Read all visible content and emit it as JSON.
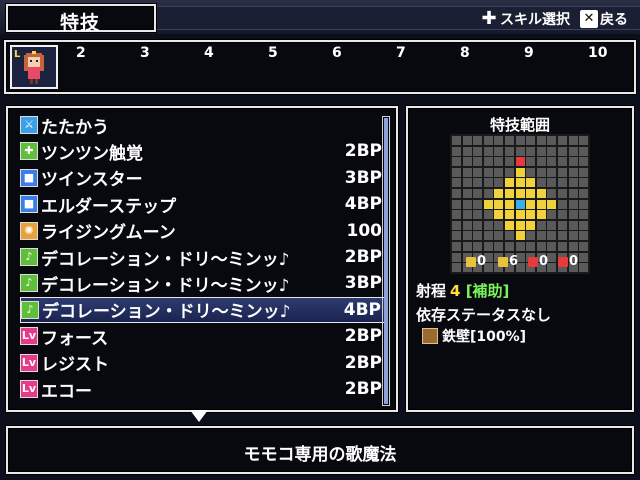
{
  "header": {
    "title": "特技",
    "hints": [
      {
        "icon": "dpad-icon",
        "label": "スキル選択"
      },
      {
        "icon": "close-button-icon",
        "label": "戻る"
      }
    ]
  },
  "party": {
    "slot1_marker": "L",
    "slot_numbers": [
      "2",
      "3",
      "4",
      "5",
      "6",
      "7",
      "8",
      "9",
      "10"
    ]
  },
  "skills": [
    {
      "name": "たたかう",
      "cost": "",
      "icon": "sword-icon",
      "icon_color": "#3aa0e8",
      "icon_glyph": "⚔"
    },
    {
      "name": "ツンツン触覚",
      "cost": "2BP",
      "icon": "plus-icon",
      "icon_color": "#5fbf3a",
      "icon_glyph": "✚"
    },
    {
      "name": "ツインスター",
      "cost": "3BP",
      "icon": "square-icon",
      "icon_color": "#3a7ee8",
      "icon_glyph": "■"
    },
    {
      "name": "エルダーステップ",
      "cost": "4BP",
      "icon": "square-icon",
      "icon_color": "#3a7ee8",
      "icon_glyph": "■"
    },
    {
      "name": "ライジングムーン",
      "cost": "100",
      "icon": "sun-icon",
      "icon_color": "#e8a23a",
      "icon_glyph": "✺"
    },
    {
      "name": "デコレーション・ドリ〜ミンッ♪",
      "cost": "2BP",
      "icon": "music-icon",
      "icon_color": "#5fbf3a",
      "icon_glyph": "♪"
    },
    {
      "name": "デコレーション・ドリ〜ミンッ♪",
      "cost": "3BP",
      "icon": "music-plus-icon",
      "icon_color": "#5fbf3a",
      "icon_glyph": "♪"
    },
    {
      "name": "デコレーション・ドリ〜ミンッ♪",
      "cost": "4BP",
      "icon": "music-plus2-icon",
      "icon_color": "#5fbf3a",
      "icon_glyph": "♪"
    },
    {
      "name": "フォース",
      "cost": "2BP",
      "icon": "lv-icon",
      "icon_color": "#e83a8a",
      "icon_glyph": "Lv"
    },
    {
      "name": "レジスト",
      "cost": "2BP",
      "icon": "lv-icon",
      "icon_color": "#e83a8a",
      "icon_glyph": "Lv"
    },
    {
      "name": "エコー",
      "cost": "2BP",
      "icon": "lv-icon",
      "icon_color": "#e83a8a",
      "icon_glyph": "Lv"
    }
  ],
  "selected_index": 7,
  "range_panel": {
    "title": "特技範囲",
    "modifiers": [
      {
        "value": "0",
        "color": "#e8c23a"
      },
      {
        "value": "6",
        "color": "#e8c23a"
      },
      {
        "value": "0",
        "color": "#e83a3a"
      },
      {
        "value": "0",
        "color": "#e83a3a"
      }
    ],
    "range_label": "射程",
    "range_value": "4",
    "range_tag": "[補助]",
    "dependency": "依存ステータスなし",
    "passive": "鉄壁[100%]",
    "colors": {
      "grid_cell": "#5a5a5a",
      "area": "#f2d23a",
      "center": "#e83a3a",
      "origin": "#3ab0e8"
    }
  },
  "description": "モモコ専用の歌魔法"
}
